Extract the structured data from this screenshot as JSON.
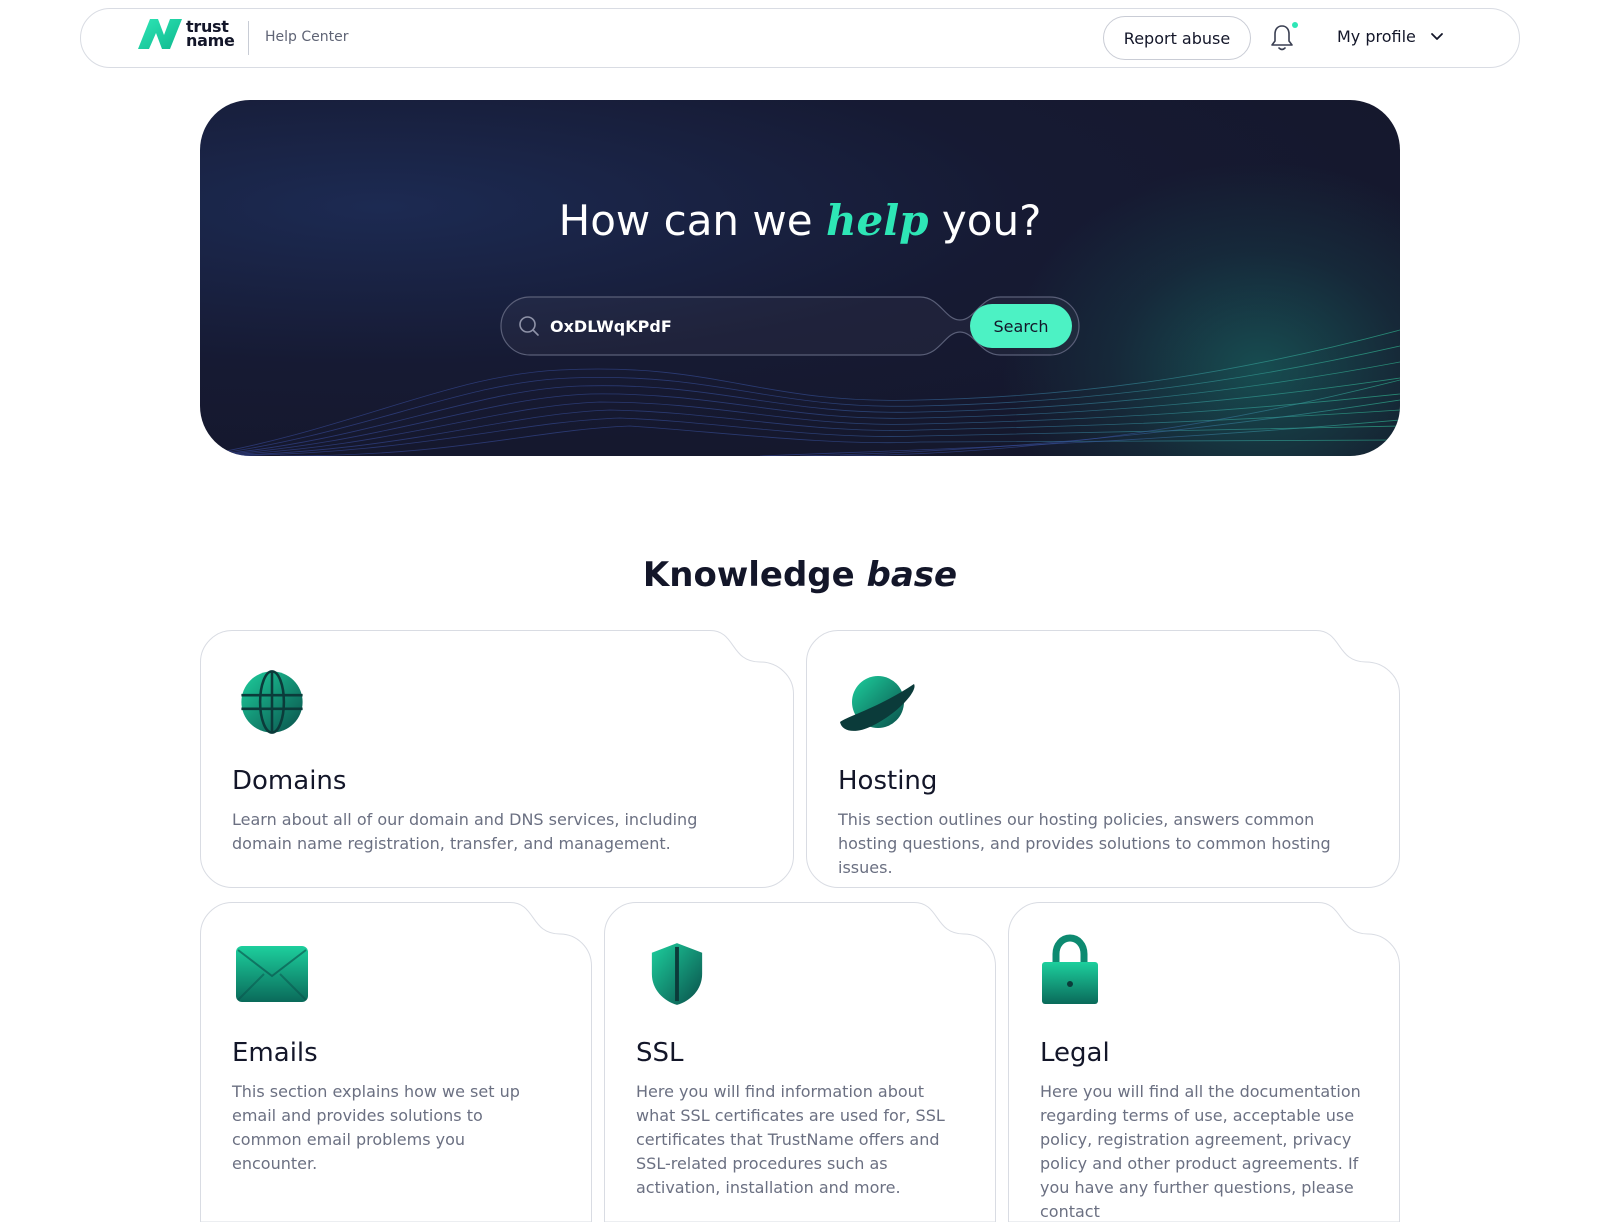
{
  "header": {
    "logo_line1": "trust",
    "logo_line2": "name",
    "section": "Help Center",
    "report_abuse": "Report abuse",
    "profile": "My profile"
  },
  "hero": {
    "title_before": "How can we ",
    "title_em": "help",
    "title_after": " you?",
    "search_value": "OxDLWqKPdF",
    "search_button": "Search"
  },
  "knowledge_base": {
    "title": "Knowledge ",
    "title_em": "base",
    "cards": [
      {
        "title": "Domains",
        "icon": "globe-icon",
        "description": "Learn about all of our domain and DNS services, including domain name registration, transfer, and management."
      },
      {
        "title": "Hosting",
        "icon": "planet-icon",
        "description": "This section outlines our hosting policies, answers common hosting questions, and provides solutions to common hosting issues."
      },
      {
        "title": "Emails",
        "icon": "envelope-icon",
        "description": "This section explains how we set up email and provides solutions to common email problems you encounter."
      },
      {
        "title": "SSL",
        "icon": "shield-icon",
        "description": "Here you will find information about what SSL certificates are used for, SSL certificates that TrustName offers and SSL-related procedures such as activation, installation and more."
      },
      {
        "title": "Legal",
        "icon": "padlock-icon",
        "description": "Here you will find all the documentation regarding terms of use, acceptable use policy, registration agreement, privacy policy and other product agreements. If you have any further questions, please contact"
      }
    ]
  },
  "colors": {
    "accent": "#2ee6b6",
    "button": "#4cf2c4",
    "hero_bg": "#141628",
    "text_dark": "#131629",
    "text_muted": "#6b7082"
  }
}
